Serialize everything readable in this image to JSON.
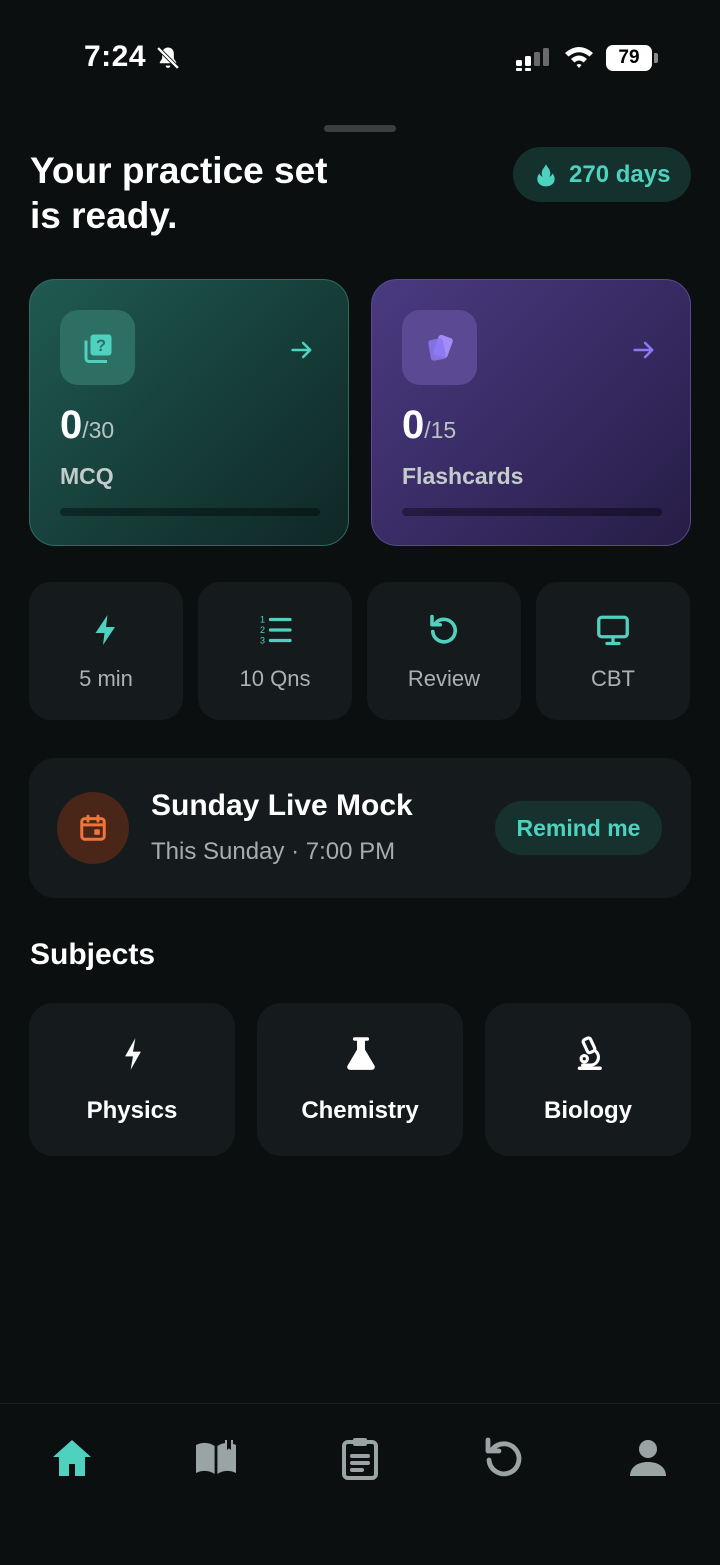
{
  "status_bar": {
    "time": "7:24",
    "battery": "79",
    "icons": [
      "bell-off-icon",
      "signal-icon",
      "wifi-icon",
      "battery-icon"
    ]
  },
  "header": {
    "title": "Your practice set is ready.",
    "streak_label": "270 days",
    "streak_icon": "flame-icon"
  },
  "practice_cards": [
    {
      "id": "mcq",
      "done": "0",
      "total": "/30",
      "label": "MCQ",
      "icon": "question-cards-icon",
      "progress": 0,
      "accent": "#4fd1bf"
    },
    {
      "id": "flashcards",
      "done": "0",
      "total": "/15",
      "label": "Flashcards",
      "icon": "cards-icon",
      "progress": 0,
      "accent": "#8c78f0"
    }
  ],
  "quick_actions": [
    {
      "label": "5 min",
      "icon": "lightning-icon"
    },
    {
      "label": "10 Qns",
      "icon": "numbered-list-icon"
    },
    {
      "label": "Review",
      "icon": "refresh-icon"
    },
    {
      "label": "CBT",
      "icon": "monitor-icon"
    }
  ],
  "live_mock": {
    "title": "Sunday Live Mock",
    "subtitle": "This Sunday · 7:00 PM",
    "button": "Remind me",
    "icon": "calendar-icon"
  },
  "subjects": {
    "title": "Subjects",
    "items": [
      {
        "label": "Physics",
        "icon": "lightning-icon"
      },
      {
        "label": "Chemistry",
        "icon": "flask-icon"
      },
      {
        "label": "Biology",
        "icon": "microscope-icon"
      }
    ]
  },
  "bottom_nav": [
    {
      "name": "home",
      "icon": "home-icon",
      "active": true
    },
    {
      "name": "library",
      "icon": "book-icon",
      "active": false
    },
    {
      "name": "tests",
      "icon": "clipboard-icon",
      "active": false
    },
    {
      "name": "history",
      "icon": "refresh-icon",
      "active": false
    },
    {
      "name": "profile",
      "icon": "person-icon",
      "active": false
    }
  ],
  "colors": {
    "accent": "#4fd1bf",
    "purple_accent": "#8c78f0",
    "orange_accent": "#f2743a",
    "background": "#0b0f0f",
    "tile": "#151b1c"
  }
}
